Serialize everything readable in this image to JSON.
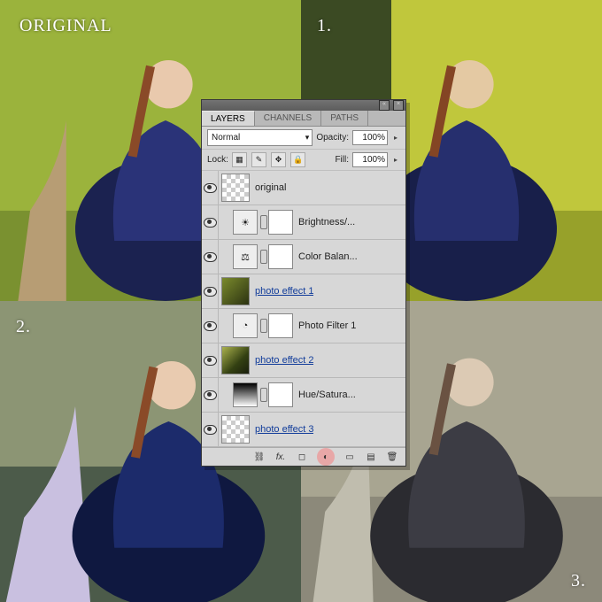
{
  "quads": {
    "tl_label": "ORIGINAL",
    "tr_label": "1.",
    "bl_label": "2.",
    "br_label": "3."
  },
  "panel": {
    "tabs": [
      "LAYERS",
      "CHANNELS",
      "PATHS"
    ],
    "active_tab": 0,
    "blend_mode": "Normal",
    "opacity_label": "Opacity:",
    "opacity_value": "100%",
    "lock_label": "Lock:",
    "fill_label": "Fill:",
    "fill_value": "100%"
  },
  "layers": [
    {
      "type": "image",
      "name": "original",
      "link": false,
      "thumb": "checker"
    },
    {
      "type": "adjustment",
      "name": "Brightness/...",
      "icon": "☀",
      "indent": true
    },
    {
      "type": "adjustment",
      "name": "Color Balan...",
      "icon": "⚖",
      "indent": true
    },
    {
      "type": "image",
      "name": "photo effect 1",
      "link": true,
      "thumb": "photo1"
    },
    {
      "type": "adjustment",
      "name": "Photo Filter 1",
      "icon": "◔",
      "indent": true
    },
    {
      "type": "image",
      "name": "photo effect 2",
      "link": true,
      "thumb": "photo2"
    },
    {
      "type": "adjustment",
      "name": "Hue/Satura...",
      "icon": "grad",
      "indent": true
    },
    {
      "type": "image",
      "name": "photo effect 3",
      "link": true,
      "thumb": "checker"
    }
  ],
  "footer_icons": [
    "link",
    "fx",
    "mask",
    "adjust",
    "group",
    "new",
    "trash"
  ]
}
